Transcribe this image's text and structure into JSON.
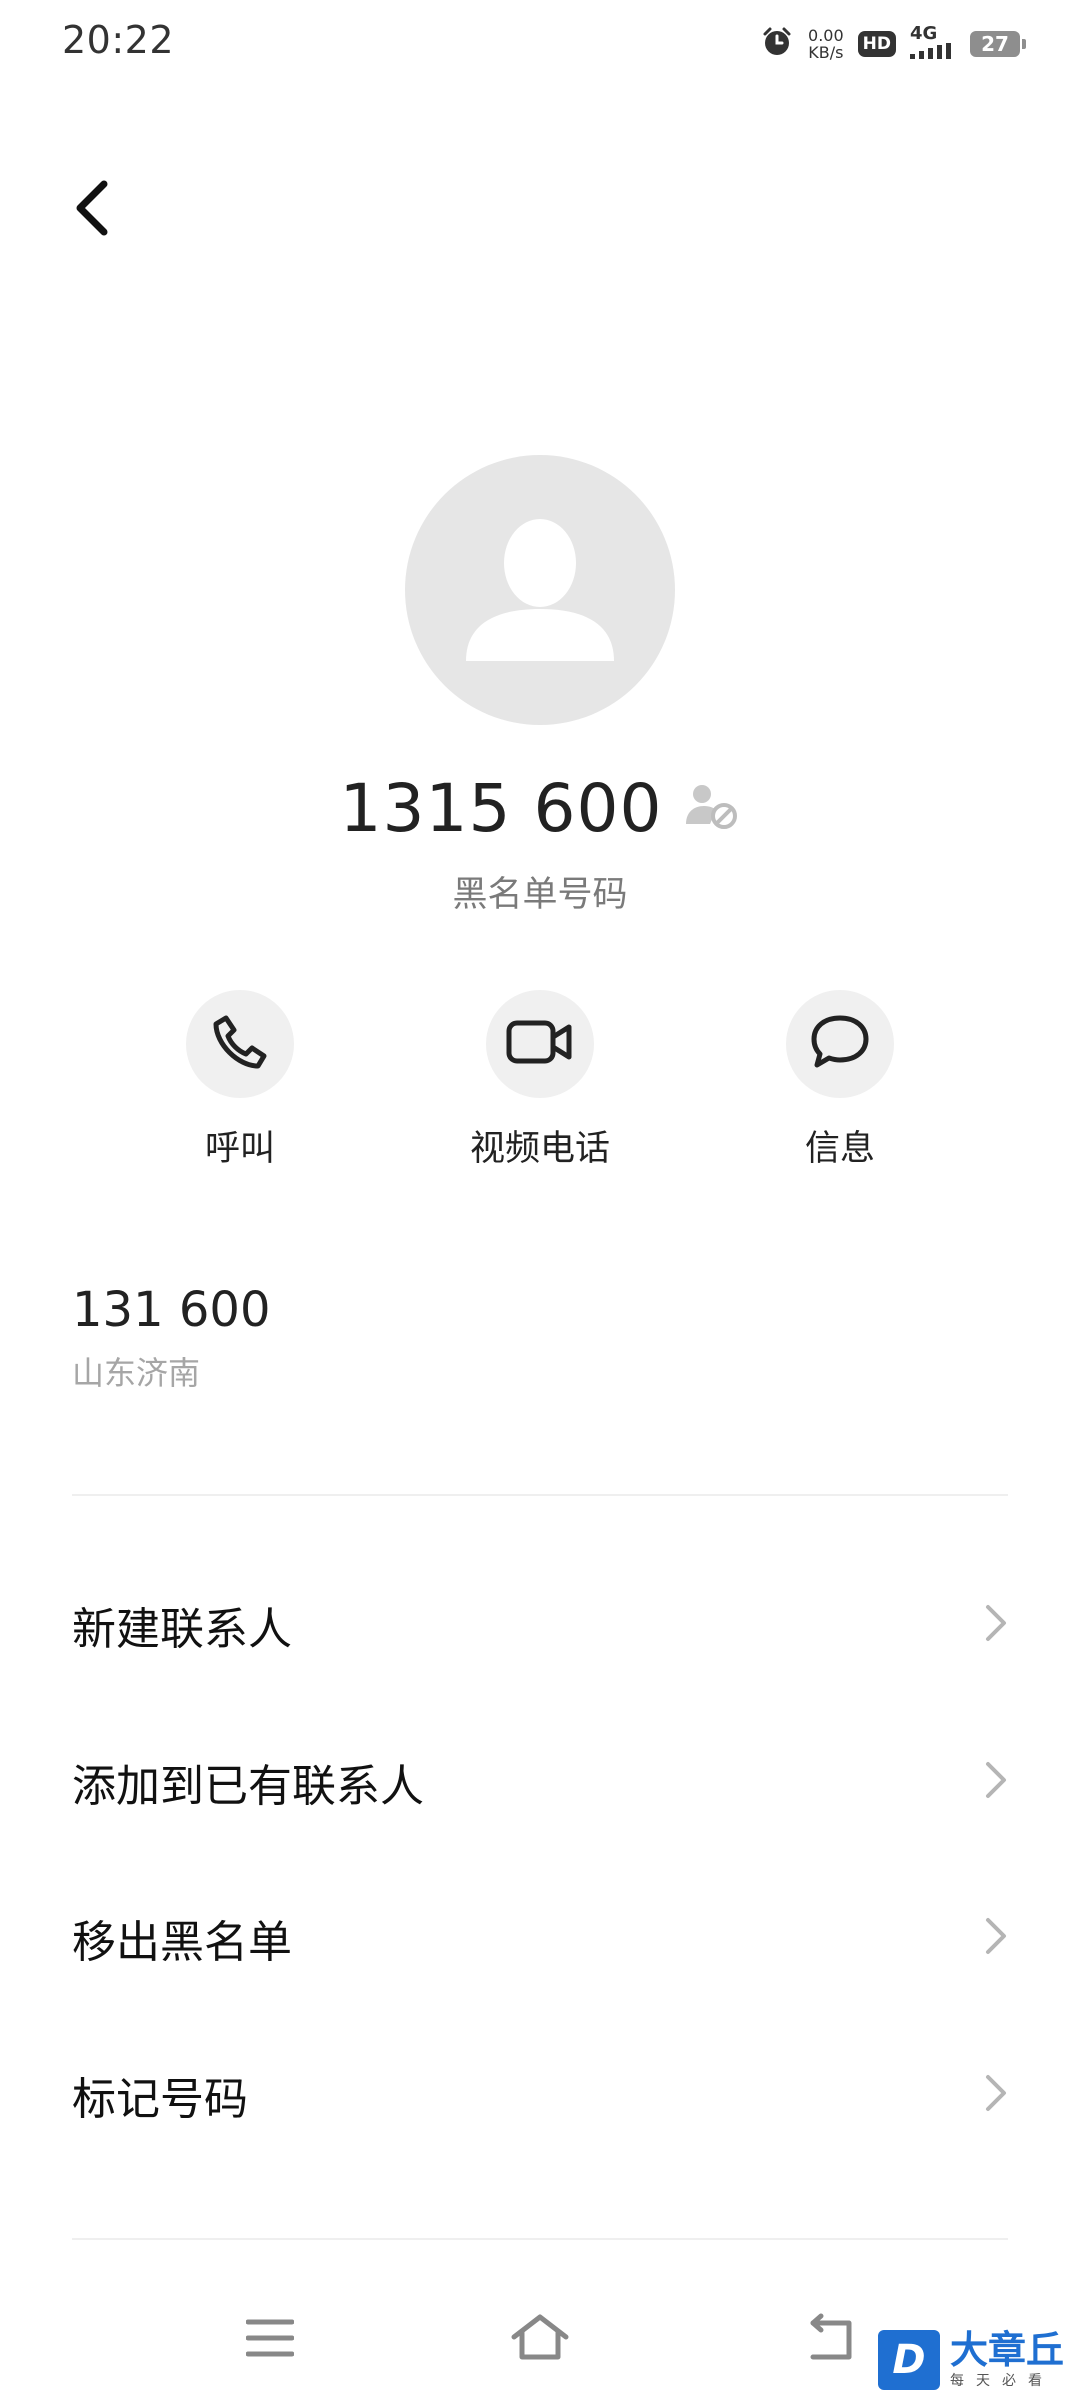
{
  "status_bar": {
    "time": "20:22",
    "net_speed_value": "0.00",
    "net_speed_unit": "KB/s",
    "hd_label": "HD",
    "network_label": "4G",
    "battery_level": "27"
  },
  "contact": {
    "display_number": "1315     600",
    "subtitle": "黑名单号码",
    "number_detail": "131         600",
    "location": "山东济南"
  },
  "actions": [
    {
      "label": "呼叫"
    },
    {
      "label": "视频电话"
    },
    {
      "label": "信息"
    }
  ],
  "menu": [
    {
      "label": "新建联系人"
    },
    {
      "label": "添加到已有联系人"
    },
    {
      "label": "移出黑名单"
    },
    {
      "label": "标记号码"
    }
  ],
  "watermark": {
    "main": "大章丘",
    "sub": "每天必看",
    "logo_letter": "D"
  },
  "colors": {
    "avatar_bg": "#e6e6e6",
    "action_bg": "#f0f0f0",
    "subtitle_text": "#7a7a7a",
    "watermark_blue": "#1f6fd1"
  }
}
